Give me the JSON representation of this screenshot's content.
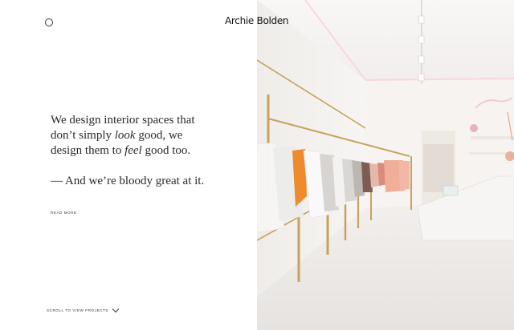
{
  "brand": {
    "name_part1": "Archie",
    "name_part2": "Bolden"
  },
  "hero": {
    "line1_a": "We design interior spaces that",
    "line2_a": "don’t simply ",
    "line2_em": "look",
    "line2_b": " good, we",
    "line3_a": "design them to ",
    "line3_em": "feel",
    "line3_b": " good too.",
    "line4": "— And we’re bloody great at it."
  },
  "links": {
    "read_more": "READ MORE",
    "scroll": "SCROLL TO VIEW PROJECTS"
  },
  "icons": {
    "menu": "circle-menu-icon",
    "scroll": "chevron-down-icon"
  },
  "colors": {
    "accent_brass": "#c7a25c",
    "wall": "#f4f1ef",
    "floor": "#ebe8e6",
    "neon": "#f5c7d6"
  }
}
